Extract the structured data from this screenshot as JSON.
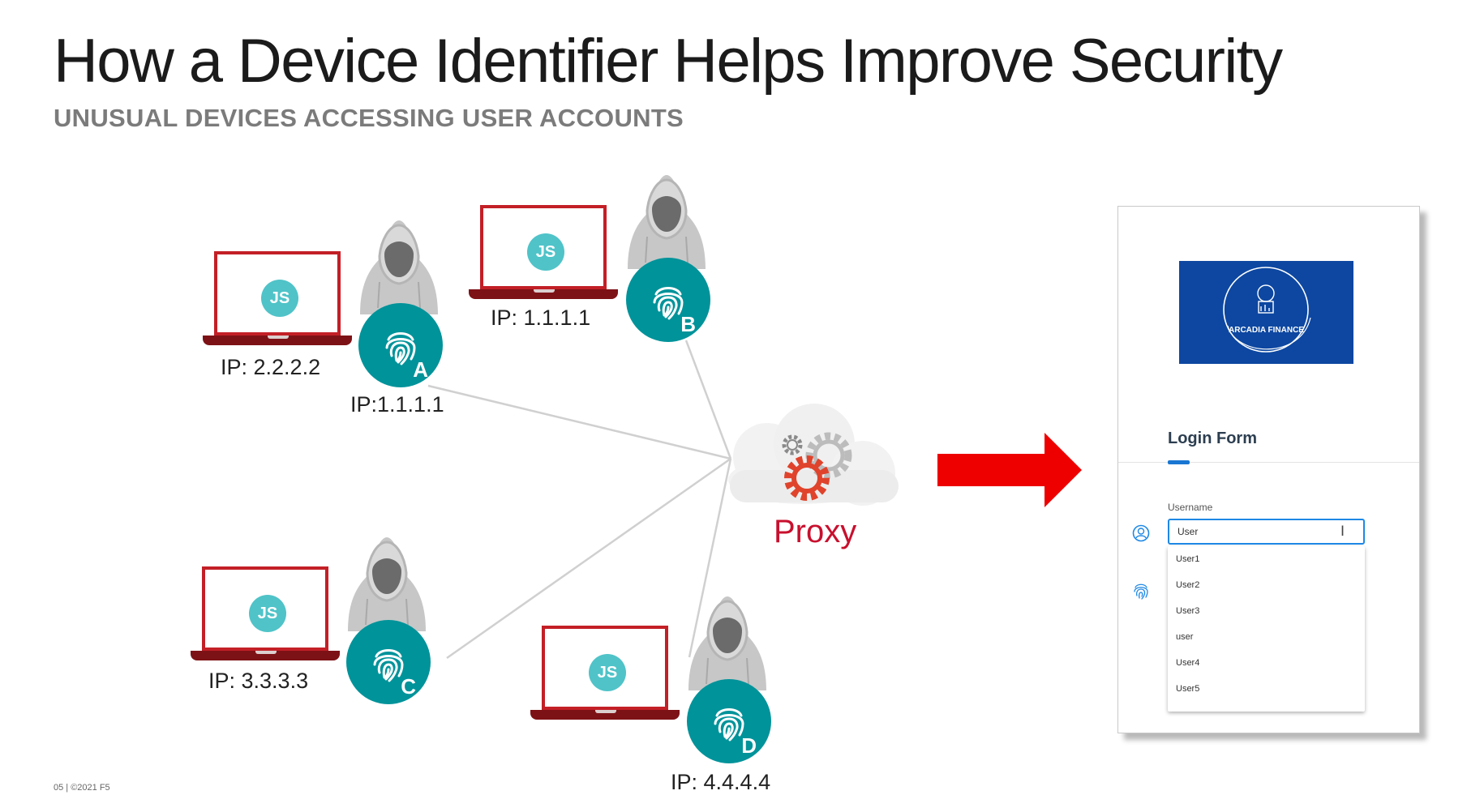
{
  "title": "How a Device Identifier Helps Improve Security",
  "subtitle": "UNUSUAL DEVICES ACCESSING USER ACCOUNTS",
  "js_badge_text": "JS",
  "colors": {
    "laptop_frame": "#c31f26",
    "laptop_base": "#7d1216",
    "js_badge": "#4fc3c8",
    "fingerprint_badge": "#00939a",
    "proxy_gear": "#e0432b",
    "proxy_label": "#c8102e",
    "arrow": "#ee0000",
    "logo_background": "#0d47a1",
    "input_border": "#1e88e5"
  },
  "devices": [
    {
      "id": "A",
      "laptop_ip": "IP: 2.2.2.2",
      "user_ip": "IP:1.1.1.1"
    },
    {
      "id": "B",
      "laptop_ip": "IP: 1.1.1.1"
    },
    {
      "id": "C",
      "laptop_ip": "IP: 3.3.3.3"
    },
    {
      "id": "D",
      "user_ip": "IP: 4.4.4.4"
    }
  ],
  "proxy": {
    "label": "Proxy",
    "icon": "cloud-gear-icon"
  },
  "arrow_icon": "right-arrow-icon",
  "login_form": {
    "logo_text": "ARCADIA FINANCE",
    "title": "Login Form",
    "username_label": "Username",
    "username_value": "User",
    "cursor_icon": "text-cursor-icon",
    "suggestions": [
      "User1",
      "User2",
      "User3",
      "user",
      "User4",
      "User5"
    ]
  },
  "footer": "05 | ©2021 F5"
}
